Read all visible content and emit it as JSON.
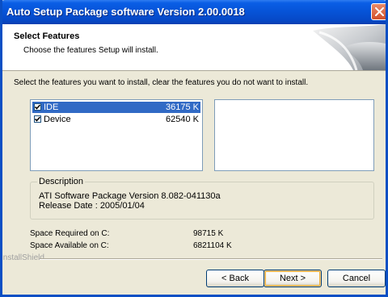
{
  "window": {
    "title": "Auto Setup Package software Version 2.00.0018"
  },
  "header": {
    "title": "Select Features",
    "subtitle": "Choose the features Setup will install."
  },
  "instruction": "Select the features you want to install, clear the features you do not want to install.",
  "features": [
    {
      "label": "IDE",
      "size": "36175 K",
      "checked": true,
      "selected": true
    },
    {
      "label": "Device",
      "size": "62540 K",
      "checked": true,
      "selected": false
    }
  ],
  "description": {
    "legend": "Description",
    "line1": "ATI Software Package Version 8.082-041130a",
    "line2": "Release Date : 2005/01/04"
  },
  "space": {
    "required_label": "Space Required on  C:",
    "required_value": "98715 K",
    "available_label": "Space Available on  C:",
    "available_value": "6821104 K"
  },
  "installshield": "InstallShield",
  "buttons": {
    "back": "< Back",
    "next": "Next >",
    "cancel": "Cancel"
  },
  "colors": {
    "titlebar": "#0653d6",
    "selection": "#316ac5",
    "dialog_bg": "#ece9d8",
    "close_button": "#d2502b"
  },
  "icons": {
    "close": "close-icon",
    "checkbox": "checkmark-icon"
  }
}
